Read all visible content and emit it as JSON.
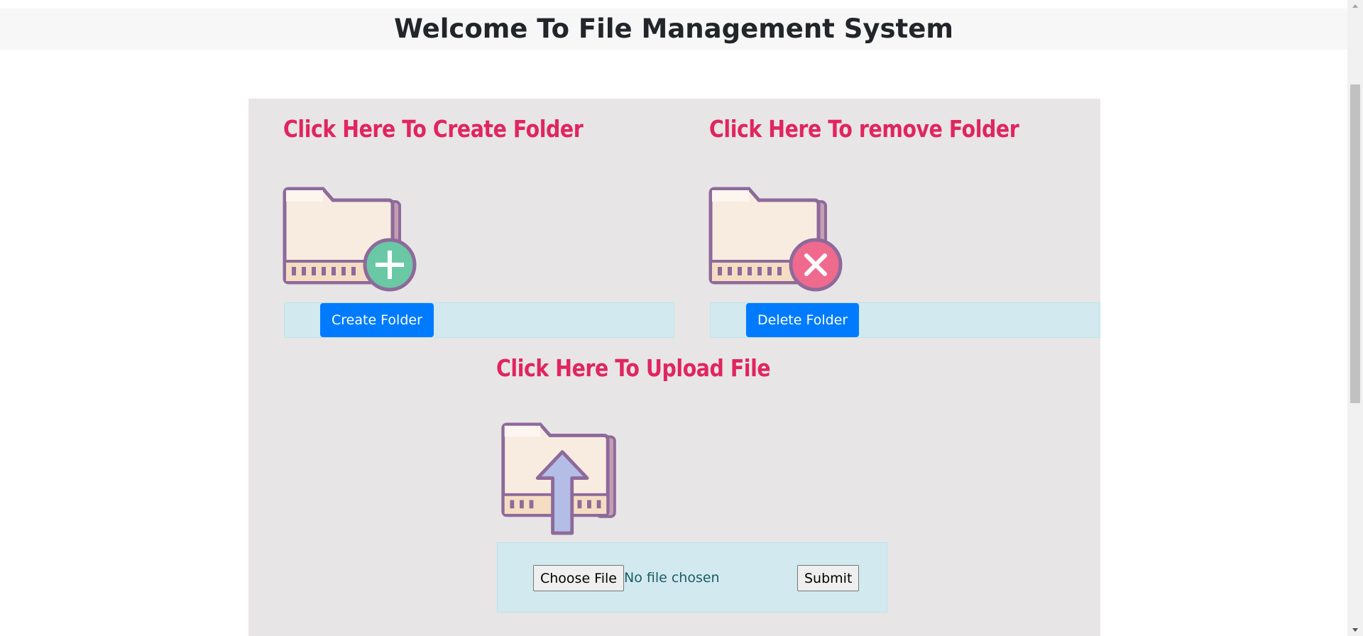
{
  "header": {
    "title": "Welcome To File Management System"
  },
  "create": {
    "heading": "Click Here To Create Folder",
    "button_label": "Create Folder"
  },
  "remove": {
    "heading": "Click Here To remove Folder",
    "button_label": "Delete Folder"
  },
  "upload": {
    "heading": "Click Here To Upload File",
    "choose_label": "Choose File",
    "file_status": "No file chosen",
    "submit_label": "Submit"
  },
  "icons": {
    "create": "folder-add-icon",
    "remove": "folder-delete-icon",
    "upload": "folder-upload-icon"
  },
  "colors": {
    "heading": "#e0255f",
    "button": "#007bff",
    "panel": "#e8e5e6",
    "action_row": "#d1e9ef"
  }
}
